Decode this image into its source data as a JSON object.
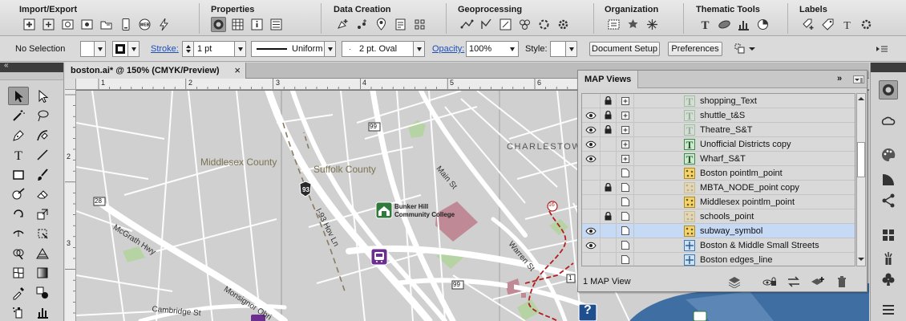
{
  "ribbon": {
    "groups": [
      {
        "title": "Import/Export"
      },
      {
        "title": "Properties"
      },
      {
        "title": "Data Creation"
      },
      {
        "title": "Geoprocessing"
      },
      {
        "title": "Organization"
      },
      {
        "title": "Thematic Tools"
      },
      {
        "title": "Labels"
      }
    ]
  },
  "control_bar": {
    "selection": "No Selection",
    "stroke_label": "Stroke:",
    "stroke_value": "1 pt",
    "profile": "Uniform",
    "brush": "2 pt. Oval",
    "opacity_label": "Opacity:",
    "opacity_value": "100%",
    "style_label": "Style:",
    "document_setup": "Document Setup",
    "preferences": "Preferences"
  },
  "document": {
    "tab_title": "boston.ai* @ 150% (CMYK/Preview)",
    "close_glyph": "×",
    "ruler_marks": [
      "1",
      "2",
      "3",
      "4",
      "5",
      "6"
    ],
    "ruler_v_marks": [
      "2",
      "3"
    ]
  },
  "map": {
    "labels": {
      "middlesex": "Middlesex County",
      "suffolk": "Suffolk County",
      "charlestown": "CHARLESTOW",
      "mcgrath": "McGrath Hwy",
      "i93": "I-93 Hov Ln",
      "main": "Main St",
      "warren": "Warren St",
      "monsignor": "Monsignor Obri",
      "cambridge": "Cambridge St",
      "bunker_hill": "Bunker Hill",
      "community_college": "Community College",
      "shield_93": "93",
      "shield_99a": "99",
      "shield_99b": "99",
      "shield_28": "28",
      "shield_16": "16",
      "shield_1": "1"
    }
  },
  "map_views": {
    "title": "MAP Views",
    "footer": "1 MAP View",
    "rows": [
      {
        "name": "shopping_Text",
        "eye": false,
        "lock": true,
        "type": "text-faded",
        "selected": false
      },
      {
        "name": "shuttle_t&S",
        "eye": true,
        "lock": true,
        "type": "text-faded",
        "selected": false
      },
      {
        "name": "Theatre_S&T",
        "eye": true,
        "lock": true,
        "type": "text-faded",
        "selected": false
      },
      {
        "name": "Unofficial Districts copy",
        "eye": true,
        "lock": false,
        "type": "text",
        "selected": false
      },
      {
        "name": "Wharf_S&T",
        "eye": true,
        "lock": false,
        "type": "text",
        "selected": false
      },
      {
        "name": "Boston pointlm_point",
        "eye": false,
        "lock": false,
        "type": "point",
        "selected": false
      },
      {
        "name": "MBTA_NODE_point copy",
        "eye": false,
        "lock": true,
        "type": "point-faded",
        "selected": false
      },
      {
        "name": "Middlesex pointlm_point",
        "eye": false,
        "lock": false,
        "type": "point",
        "selected": false
      },
      {
        "name": "schools_point",
        "eye": false,
        "lock": true,
        "type": "point-faded",
        "selected": false
      },
      {
        "name": "subway_symbol",
        "eye": true,
        "lock": false,
        "type": "point",
        "selected": true
      },
      {
        "name": "Boston & Middle Small Streets",
        "eye": true,
        "lock": false,
        "type": "line",
        "selected": false
      },
      {
        "name": "Boston edges_line",
        "eye": false,
        "lock": false,
        "type": "line",
        "selected": false
      }
    ]
  }
}
